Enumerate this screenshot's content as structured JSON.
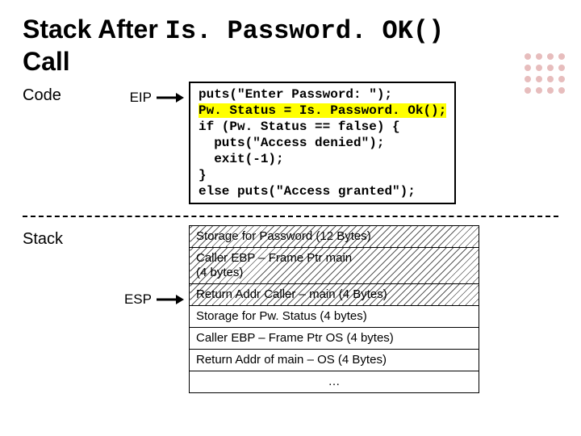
{
  "title_plain": "Stack After ",
  "title_mono": "Is. Password. OK()",
  "title_line2": "Call",
  "labels": {
    "code": "Code",
    "stack": "Stack",
    "eip": "EIP",
    "esp": "ESP"
  },
  "code_lines": [
    "puts(\"Enter Password: \");",
    "Pw. Status = Is. Password. Ok();",
    "if (Pw. Status == false) {",
    "  puts(\"Access denied\");",
    "  exit(-1);",
    "}",
    "else puts(\"Access granted\");"
  ],
  "code_highlight_index": 1,
  "stack_rows": [
    {
      "text": "Storage for Password (12 Bytes)",
      "hatched": true
    },
    {
      "text": "Caller EBP – Frame Ptr main\n   (4 bytes)",
      "hatched": true
    },
    {
      "text": "Return Addr Caller – main (4 Bytes)",
      "hatched": true
    },
    {
      "text": "Storage for Pw. Status (4 bytes)"
    },
    {
      "text": "Caller EBP – Frame Ptr OS (4 bytes)"
    },
    {
      "text": "Return Addr of main – OS (4 Bytes)"
    },
    {
      "text": "…",
      "center": true
    }
  ],
  "esp_row_index": 2
}
